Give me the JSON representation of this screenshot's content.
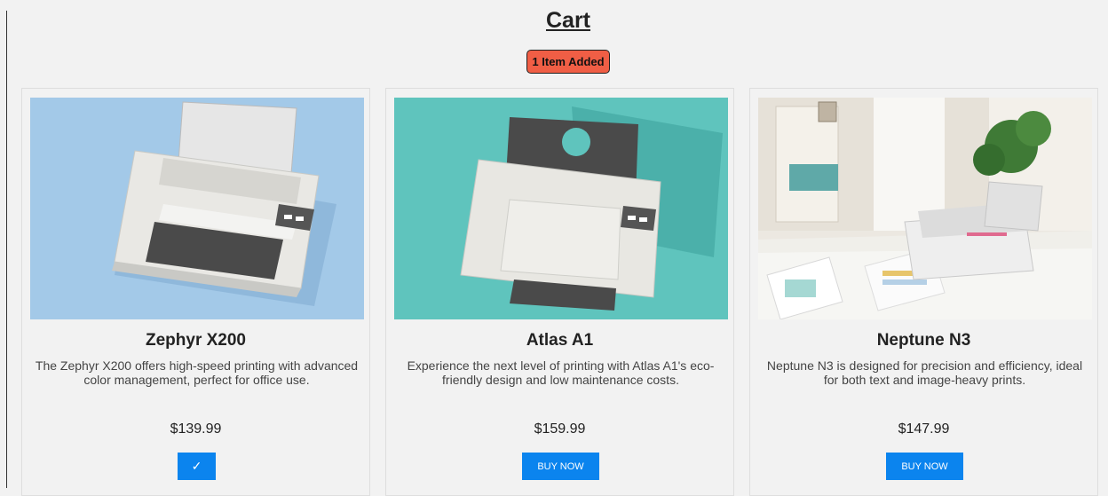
{
  "page": {
    "title": "Cart",
    "badge": "1 Item Added"
  },
  "products": [
    {
      "name": "Zephyr X200",
      "description": "The Zephyr X200 offers high-speed printing with advanced color management, perfect for office use.",
      "price": "$139.99",
      "button_label": "✓",
      "added": true
    },
    {
      "name": "Atlas A1",
      "description": "Experience the next level of printing with Atlas A1's eco-friendly design and low maintenance costs.",
      "price": "$159.99",
      "button_label": "BUY NOW",
      "added": false
    },
    {
      "name": "Neptune N3",
      "description": "Neptune N3 is designed for precision and efficiency, ideal for both text and image-heavy prints.",
      "price": "$147.99",
      "button_label": "BUY NOW",
      "added": false
    }
  ],
  "colors": {
    "background": "#f2f2f2",
    "badge": "#f05e45",
    "button": "#0b84ee"
  }
}
